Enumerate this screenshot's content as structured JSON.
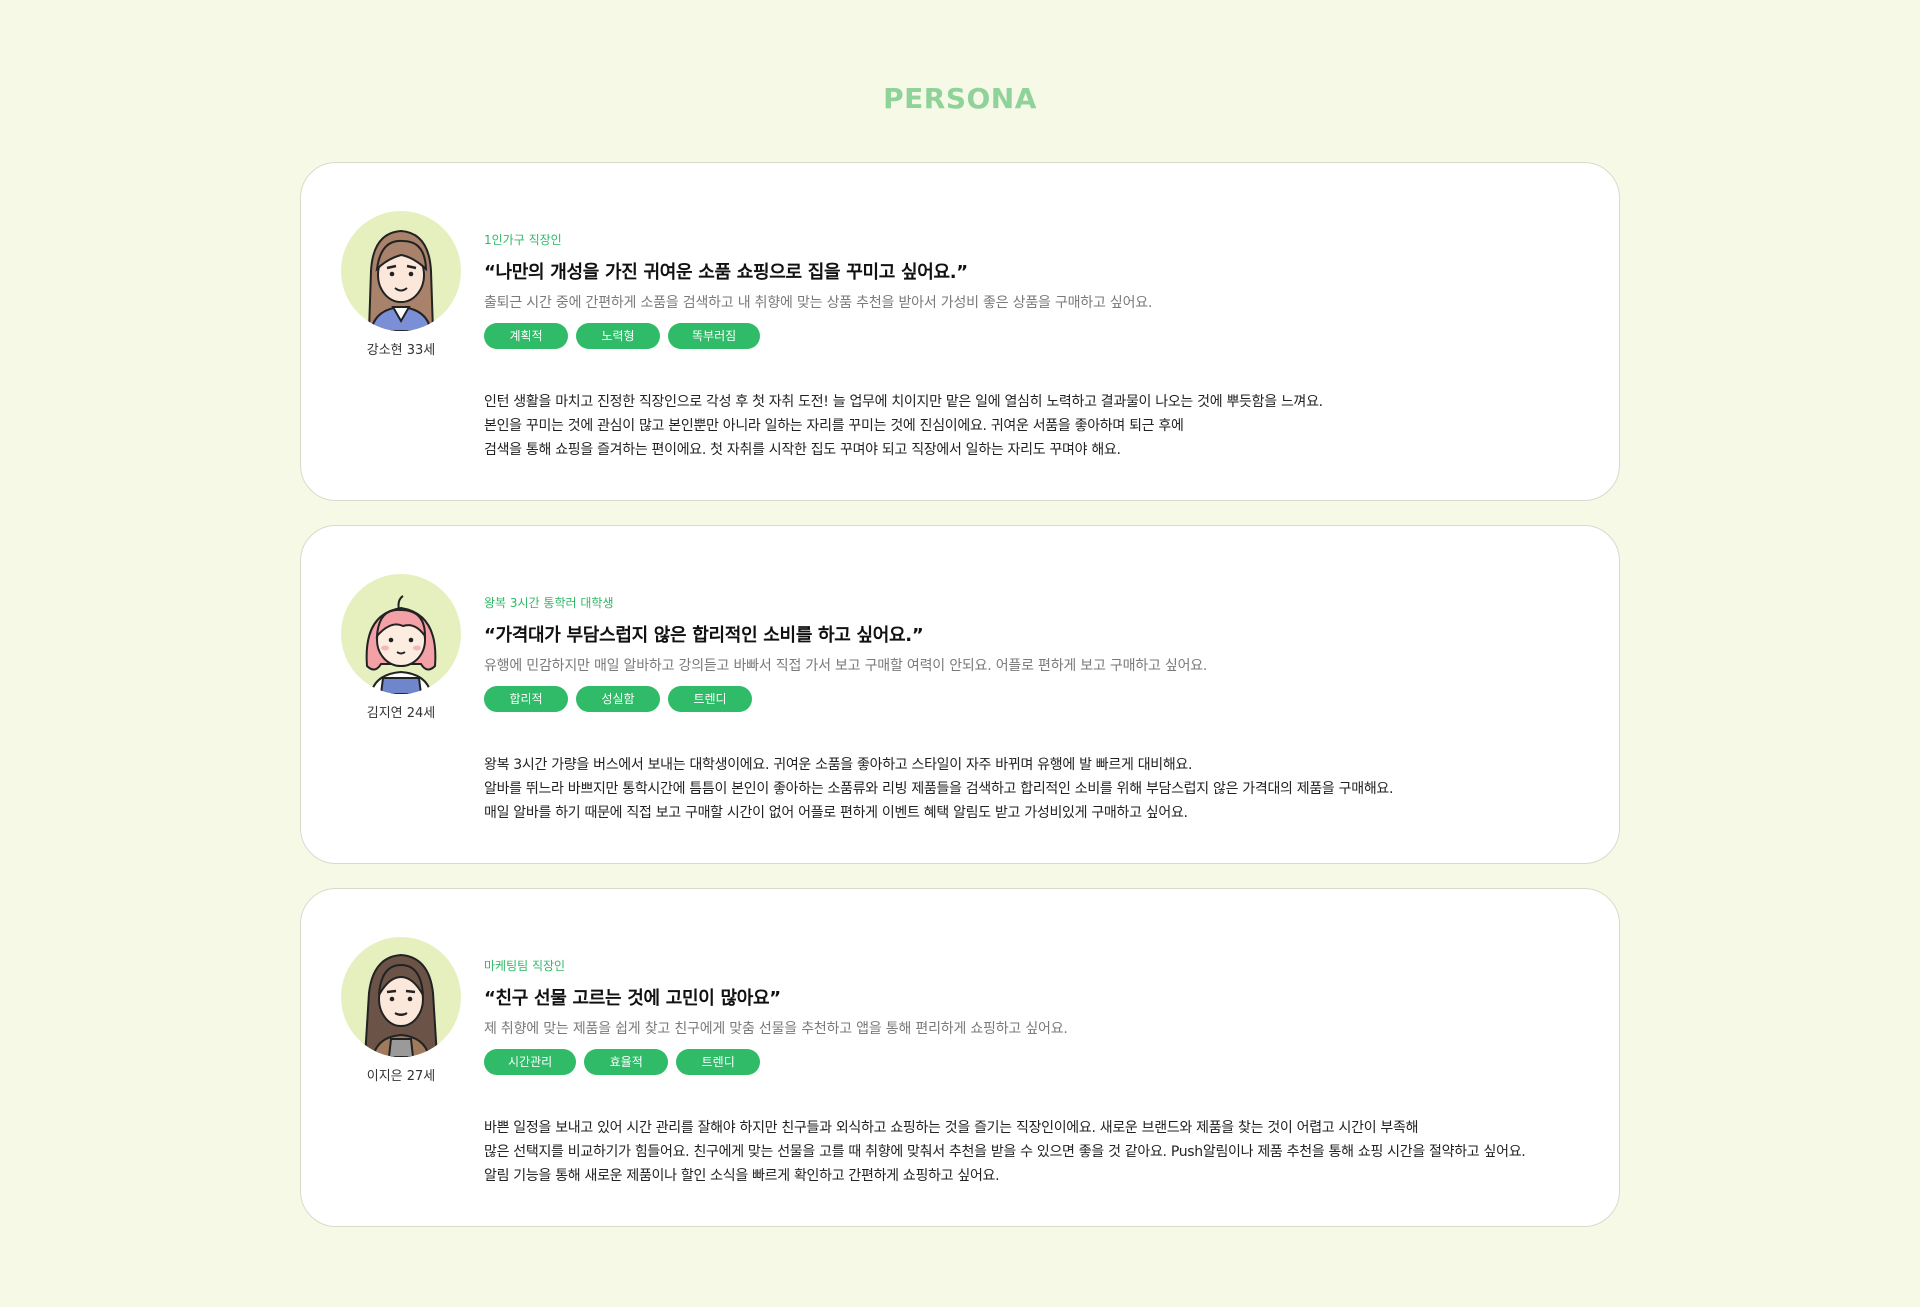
{
  "page": {
    "title": "PERSONA"
  },
  "colors": {
    "background": "#f6f9e6",
    "accent": "#2fbb67",
    "title": "#8fd39a",
    "avatar_bg": "#e6f0bf"
  },
  "personas": [
    {
      "avatar_icon": "woman-brown-hair-avatar",
      "name": "강소현 33세",
      "role": "1인가구 직장인",
      "quote": "“나만의 개성을 가진 귀여운 소품 쇼핑으로 집을 꾸미고 싶어요.”",
      "summary": "출퇴근 시간 중에 간편하게 소품을 검색하고 내 취향에 맞는 상품 추천을 받아서 가성비 좋은 상품을 구매하고 싶어요.",
      "tags": [
        "계획적",
        "노력형",
        "똑부러짐"
      ],
      "description": [
        "인턴 생활을 마치고 진정한 직장인으로 각성 후 첫 자취 도전! 늘 업무에 치이지만 맡은 일에 열심히 노력하고 결과물이 나오는 것에 뿌듯함을 느껴요.",
        "본인을 꾸미는 것에 관심이 많고 본인뿐만 아니라 일하는 자리를 꾸미는 것에 진심이에요. 귀여운 서품을 좋아하며 퇴근 후에",
        "검색을 통해 쇼핑을 즐겨하는 편이에요. 첫 자취를 시작한 집도 꾸며야 되고 직장에서 일하는 자리도 꾸며야 해요."
      ]
    },
    {
      "avatar_icon": "woman-pink-hair-avatar",
      "name": "김지연 24세",
      "role": "왕복 3시간 통학러 대학생",
      "quote": "“가격대가 부담스럽지 않은 합리적인 소비를 하고 싶어요.”",
      "summary": "유행에 민감하지만 매일 알바하고 강의듣고 바빠서 직접 가서 보고 구매할 여력이 안되요. 어플로 편하게 보고 구매하고 싶어요.",
      "tags": [
        "합리적",
        "성실함",
        "트렌디"
      ],
      "description": [
        "왕복 3시간 가량을 버스에서 보내는 대학생이에요. 귀여운 소품을 좋아하고 스타일이 자주 바뀌며 유행에 발 빠르게 대비해요.",
        "알바를 뛰느라 바쁘지만 통학시간에 틈틈이 본인이 좋아하는 소품류와 리빙 제품들을 검색하고 합리적인 소비를 위해 부담스럽지 않은 가격대의 제품을 구매해요.",
        "매일 알바를 하기 때문에 직접 보고 구매할 시간이 없어 어플로 편하게 이벤트 혜택 알림도 받고 가성비있게 구매하고 싶어요."
      ]
    },
    {
      "avatar_icon": "woman-dark-hair-avatar",
      "name": "이지은 27세",
      "role": "마케팅팀 직장인",
      "quote": "“친구 선물 고르는 것에 고민이 많아요”",
      "summary": "제 취향에 맞는 제품을 쉽게 찾고 친구에게 맞춤 선물을 추천하고 앱을 통해 편리하게 쇼핑하고 싶어요.",
      "tags": [
        "시간관리",
        "효율적",
        "트렌디"
      ],
      "description": [
        "바쁜 일정을 보내고 있어 시간 관리를 잘해야 하지만 친구들과 외식하고 쇼핑하는 것을 즐기는 직장인이에요.  새로운 브랜드와 제품을 찾는 것이 어렵고 시간이 부족해",
        "많은 선택지를 비교하기가 힘들어요. 친구에게 맞는 선물을 고를 때 취향에 맞춰서 추천을 받을 수 있으면 좋을 것 같아요. Push알림이나 제품 추천을 통해 쇼핑 시간을 절약하고 싶어요.",
        "알림 기능을 통해 새로운 제품이나 할인 소식을 빠르게 확인하고 간편하게 쇼핑하고 싶어요."
      ]
    }
  ]
}
